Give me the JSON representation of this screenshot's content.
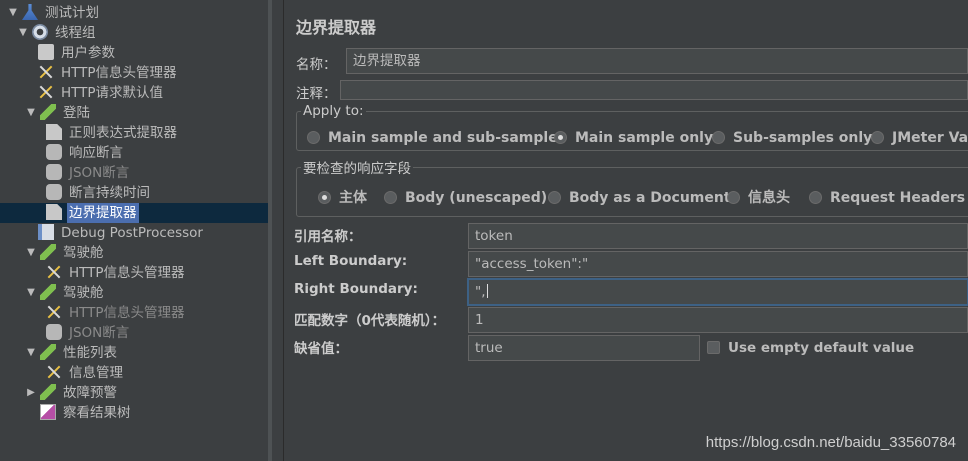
{
  "tree": {
    "nodes": [
      {
        "label": "测试计划",
        "icon": "test-plan-icon",
        "twisty": "▼"
      },
      {
        "label": "线程组",
        "icon": "gear-icon",
        "twisty": "▼"
      },
      {
        "label": "用户参数",
        "icon": "user-parameters-icon",
        "twisty": ""
      },
      {
        "label": "HTTP信息头管理器",
        "icon": "wrench-icon",
        "twisty": ""
      },
      {
        "label": "HTTP请求默认值",
        "icon": "wrench-icon",
        "twisty": ""
      },
      {
        "label": "登陆",
        "icon": "sampler-pencil-icon",
        "twisty": "▼"
      },
      {
        "label": "正则表达式提取器",
        "icon": "extractor-icon",
        "twisty": ""
      },
      {
        "label": "响应断言",
        "icon": "assertion-icon",
        "twisty": ""
      },
      {
        "label": "JSON断言",
        "icon": "assertion-icon",
        "twisty": ""
      },
      {
        "label": "断言持续时间",
        "icon": "assertion-icon",
        "twisty": ""
      },
      {
        "label": "边界提取器",
        "icon": "extractor-icon",
        "twisty": ""
      },
      {
        "label": "Debug PostProcessor",
        "icon": "debug-icon",
        "twisty": ""
      },
      {
        "label": "驾驶舱",
        "icon": "sampler-pencil-icon",
        "twisty": "▼"
      },
      {
        "label": "HTTP信息头管理器",
        "icon": "wrench-icon",
        "twisty": ""
      },
      {
        "label": "驾驶舱",
        "icon": "sampler-pencil-icon",
        "twisty": "▼"
      },
      {
        "label": "HTTP信息头管理器",
        "icon": "wrench-icon",
        "twisty": ""
      },
      {
        "label": "JSON断言",
        "icon": "assertion-icon",
        "twisty": ""
      },
      {
        "label": "性能列表",
        "icon": "sampler-pencil-icon",
        "twisty": "▼"
      },
      {
        "label": "信息管理",
        "icon": "wrench-icon",
        "twisty": ""
      },
      {
        "label": "故障预警",
        "icon": "sampler-pencil-icon",
        "twisty": "▶"
      },
      {
        "label": "察看结果树",
        "icon": "results-tree-icon",
        "twisty": ""
      }
    ]
  },
  "panel": {
    "title": "边界提取器",
    "name_label": "名称：",
    "name_value": "边界提取器",
    "comment_label": "注释：",
    "comment_value": "",
    "apply_to": {
      "legend": "Apply to:",
      "options": [
        "Main sample and sub-samples",
        "Main sample only",
        "Sub-samples only",
        "JMeter Va"
      ],
      "selected": "Main sample only"
    },
    "field_to_check": {
      "legend": "要检查的响应字段",
      "options": [
        "主体",
        "Body (unescaped)",
        "Body as a Document",
        "信息头",
        "Request Headers"
      ],
      "selected": "主体"
    },
    "ref_name_label": "引用名称：",
    "ref_name_value": "token",
    "left_boundary_label": "Left Boundary:",
    "left_boundary_value": "\"access_token\":\"",
    "right_boundary_label": "Right Boundary:",
    "right_boundary_value": "\",",
    "match_no_label": "匹配数字（0代表随机）：",
    "match_no_value": "1",
    "default_label": "缺省值：",
    "default_value": "true",
    "use_empty_default_label": "Use empty default value"
  },
  "watermark": "https://blog.csdn.net/baidu_33560784"
}
